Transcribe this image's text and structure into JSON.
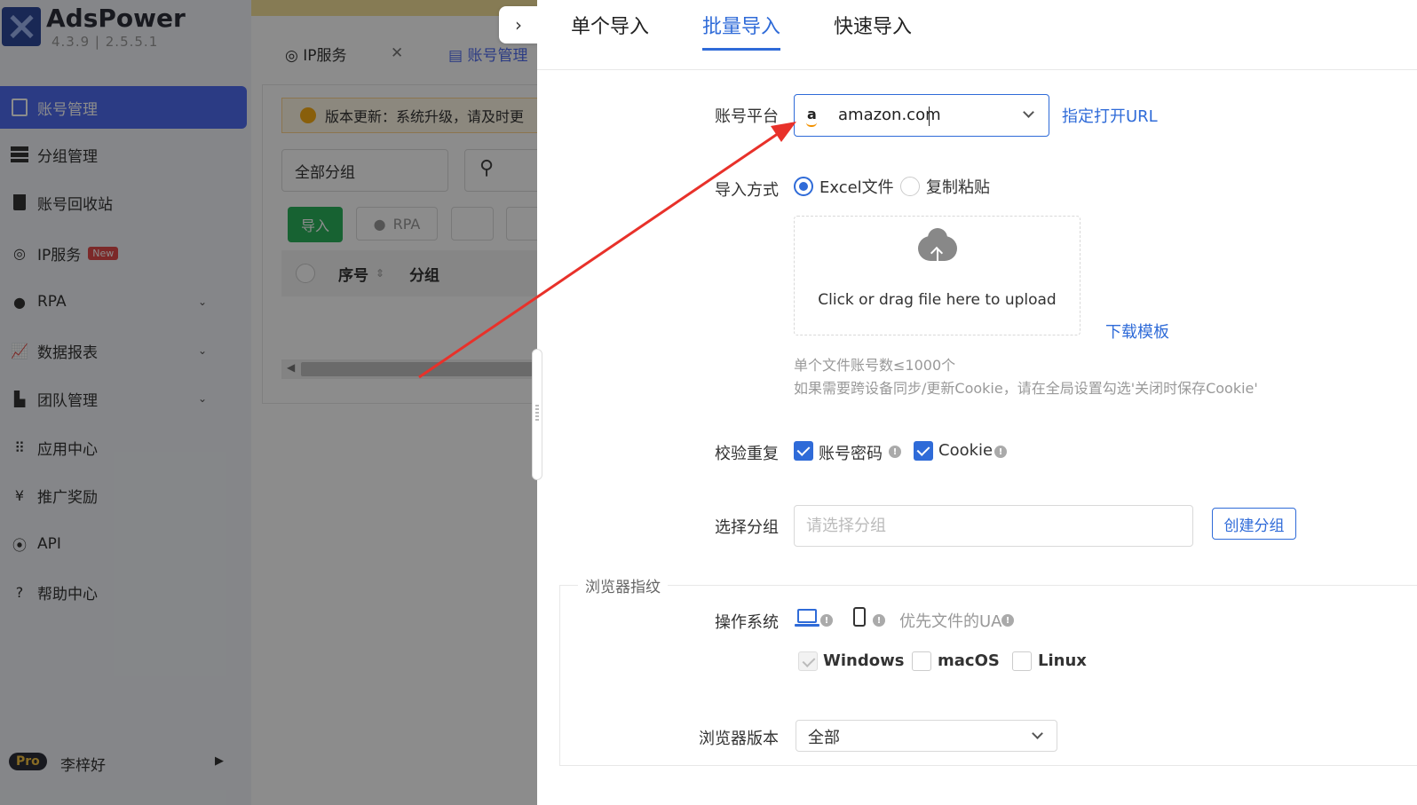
{
  "app": {
    "name": "AdsPower",
    "version": "4.3.9 | 2.5.5.1"
  },
  "sidebar": {
    "items": [
      {
        "label": "账号管理",
        "icon": "document-icon",
        "active": true
      },
      {
        "label": "分组管理",
        "icon": "group-list-icon"
      },
      {
        "label": "账号回收站",
        "icon": "trash-icon"
      },
      {
        "label": "IP服务",
        "icon": "signal-icon",
        "badge": "New"
      },
      {
        "label": "RPA",
        "icon": "robot-icon",
        "expandable": true
      },
      {
        "label": "数据报表",
        "icon": "chart-icon",
        "expandable": true
      },
      {
        "label": "团队管理",
        "icon": "building-icon",
        "expandable": true
      },
      {
        "label": "应用中心",
        "icon": "apps-grid-icon"
      },
      {
        "label": "推广奖励",
        "icon": "yuan-icon"
      },
      {
        "label": "API",
        "icon": "api-icon"
      },
      {
        "label": "帮助中心",
        "icon": "help-icon"
      }
    ],
    "user": {
      "plan": "Pro",
      "name": "李梓好"
    }
  },
  "background": {
    "tabs": [
      {
        "label": "IP服务"
      },
      {
        "label": "账号管理"
      }
    ],
    "notice": "版本更新：系统升级，请及时更",
    "group_select": "全部分组",
    "buttons": {
      "import": "导入",
      "rpa": "RPA"
    },
    "table_headers": [
      "序号",
      "分组"
    ]
  },
  "drawer": {
    "tabs": [
      {
        "label": "单个导入",
        "active": false
      },
      {
        "label": "批量导入",
        "active": true
      },
      {
        "label": "快速导入",
        "active": false
      }
    ],
    "platform": {
      "label": "账号平台",
      "value": "amazon.com",
      "logo": "a",
      "link": "指定打开URL"
    },
    "import_method": {
      "label": "导入方式",
      "options": [
        "Excel文件",
        "复制粘贴"
      ],
      "selected": "Excel文件"
    },
    "upload": {
      "text": "Click or drag file here to upload",
      "download_link": "下载模板"
    },
    "hints": [
      "单个文件账号数≤1000个",
      "如果需要跨设备同步/更新Cookie，请在全局设置勾选'关闭时保存Cookie'"
    ],
    "verify": {
      "label": "校验重复",
      "options": [
        {
          "label": "账号密码",
          "checked": true
        },
        {
          "label": "Cookie",
          "checked": true
        }
      ]
    },
    "group": {
      "label": "选择分组",
      "placeholder": "请选择分组",
      "value": "",
      "create_button": "创建分组"
    },
    "fingerprint": {
      "legend": "浏览器指纹",
      "os_label": "操作系统",
      "ua_option": "优先文件的UA",
      "os_options": [
        {
          "label": "Windows",
          "checked": true,
          "disabled": true
        },
        {
          "label": "macOS",
          "checked": false
        },
        {
          "label": "Linux",
          "checked": false
        }
      ],
      "browser_version_label": "浏览器版本",
      "browser_version_value": "全部"
    }
  },
  "colors": {
    "primary": "#2f6bd8",
    "sidebar_active": "#4f6cf0",
    "import_green": "#2ab25b",
    "annotation_arrow": "#e8312a"
  }
}
